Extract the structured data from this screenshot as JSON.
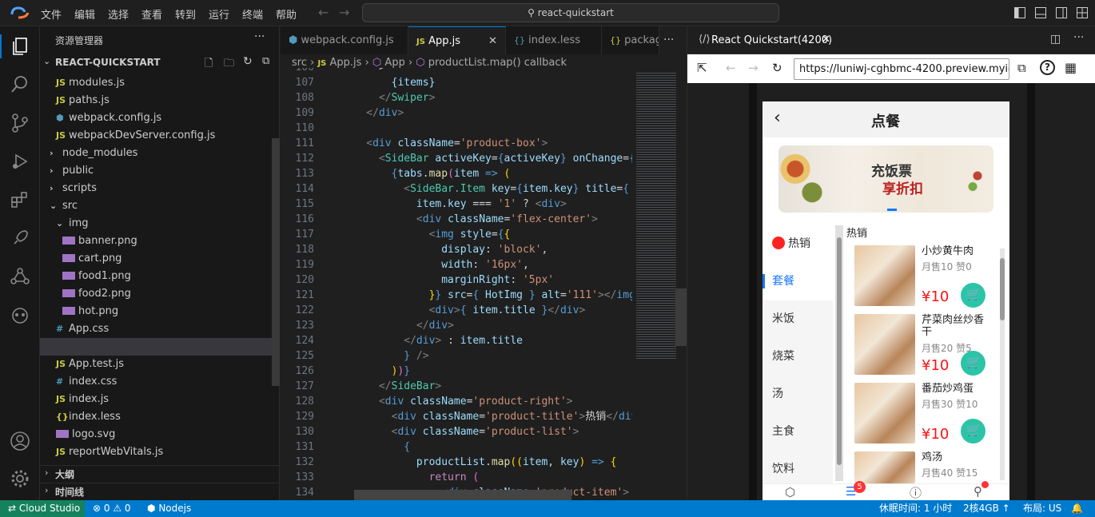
{
  "menu": [
    "文件",
    "编辑",
    "选择",
    "查看",
    "转到",
    "运行",
    "终端",
    "帮助"
  ],
  "search_placeholder": "react-quickstart",
  "explorer": {
    "title": "资源管理器",
    "project": "REACT-QUICKSTART",
    "items": [
      {
        "icon": "JS",
        "label": "modules.js",
        "indent": 1
      },
      {
        "icon": "JS",
        "label": "paths.js",
        "indent": 1
      },
      {
        "icon": "⬢",
        "label": "webpack.config.js",
        "indent": 1
      },
      {
        "icon": "JS",
        "label": "webpackDevServer.config.js",
        "indent": 1
      },
      {
        "icon": "›",
        "label": "node_modules",
        "indent": 0
      },
      {
        "icon": "›",
        "label": "public",
        "indent": 0
      },
      {
        "icon": "›",
        "label": "scripts",
        "indent": 0
      },
      {
        "icon": "⌄",
        "label": "src",
        "indent": 0
      },
      {
        "icon": "⌄",
        "label": "img",
        "indent": 1
      },
      {
        "icon": "",
        "label": "banner.png",
        "indent": 2
      },
      {
        "icon": "",
        "label": "cart.png",
        "indent": 2
      },
      {
        "icon": "",
        "label": "food1.png",
        "indent": 2
      },
      {
        "icon": "",
        "label": "food2.png",
        "indent": 2
      },
      {
        "icon": "",
        "label": "hot.png",
        "indent": 2
      },
      {
        "icon": "#",
        "label": "App.css",
        "indent": 1
      },
      {
        "icon": "JS",
        "label": "App.js",
        "indent": 1
      },
      {
        "icon": "JS",
        "label": "App.test.js",
        "indent": 1
      },
      {
        "icon": "#",
        "label": "index.css",
        "indent": 1
      },
      {
        "icon": "JS",
        "label": "index.js",
        "indent": 1
      },
      {
        "icon": "{}",
        "label": "index.less",
        "indent": 1
      },
      {
        "icon": "",
        "label": "logo.svg",
        "indent": 1
      },
      {
        "icon": "JS",
        "label": "reportWebVitals.js",
        "indent": 1
      }
    ],
    "outline": "大纲",
    "timeline": "时间线"
  },
  "tabs": [
    {
      "icon": "⬢",
      "label": "webpack.config.js"
    },
    {
      "icon": "JS",
      "label": "App.js"
    },
    {
      "icon": "{}",
      "label": "index.less"
    },
    {
      "icon": "{}",
      "label": "packag"
    }
  ],
  "breadcrumb": [
    "src",
    "JS App.js",
    "App",
    "productList.map() callback"
  ],
  "code_lines": [
    {
      "n": "106",
      "html": "<span class=\"w\">      &gt;</span>"
    },
    {
      "n": "107",
      "html": "<span class=\"w\">        </span><span class=\"a\">{items}</span>"
    },
    {
      "n": "108",
      "html": "<span class=\"g\">      &lt;/</span><span class=\"n\">Swiper</span><span class=\"g\">&gt;</span>"
    },
    {
      "n": "109",
      "html": "<span class=\"g\">    &lt;/</span><span class=\"t\">div</span><span class=\"g\">&gt;</span>"
    },
    {
      "n": "110",
      "html": ""
    },
    {
      "n": "111",
      "html": "<span class=\"g\">    &lt;</span><span class=\"t\">div</span> <span class=\"a\">className</span><span class=\"w\">=</span><span class=\"s\">'product-box'</span><span class=\"g\">&gt;</span>"
    },
    {
      "n": "112",
      "html": "<span class=\"g\">      &lt;</span><span class=\"n\">SideBar</span> <span class=\"a\">activeKey</span><span class=\"w\">=</span><span class=\"t\">{</span><span class=\"a\">activeKey</span><span class=\"t\">}</span> <span class=\"a\">onChange</span><span class=\"w\">=</span><span class=\"t\">{</span><span class=\"a\">setA</span>"
    },
    {
      "n": "113",
      "html": "<span class=\"t\">        {</span><span class=\"a\">tabs</span><span class=\"w\">.</span><span class=\"y\">map</span><span class=\"p\">(</span><span class=\"a\">item</span> <span class=\"t\">=&gt;</span> <span class=\"b\">(</span>"
    },
    {
      "n": "114",
      "html": "<span class=\"g\">          &lt;</span><span class=\"n\">SideBar.Item</span> <span class=\"a\">key</span><span class=\"w\">=</span><span class=\"t\">{</span><span class=\"a\">item.key</span><span class=\"t\">}</span> <span class=\"a\">title</span><span class=\"w\">=</span><span class=\"t\">{</span>"
    },
    {
      "n": "115",
      "html": "<span class=\"a\">            item.key</span> <span class=\"w\">===</span> <span class=\"s\">'1'</span> <span class=\"w\">?</span> <span class=\"g\">&lt;</span><span class=\"t\">div</span><span class=\"g\">&gt;</span>"
    },
    {
      "n": "116",
      "html": "<span class=\"g\">            &lt;</span><span class=\"t\">div</span> <span class=\"a\">className</span><span class=\"w\">=</span><span class=\"s\">'flex-center'</span><span class=\"g\">&gt;</span>"
    },
    {
      "n": "117",
      "html": "<span class=\"g\">              &lt;</span><span class=\"t\">img</span> <span class=\"a\">style</span><span class=\"w\">=</span><span class=\"t\">{</span><span class=\"b\">{</span>"
    },
    {
      "n": "118",
      "html": "<span class=\"a\">                display</span><span class=\"w\">:</span> <span class=\"s\">'block'</span><span class=\"w\">,</span>"
    },
    {
      "n": "119",
      "html": "<span class=\"a\">                width</span><span class=\"w\">:</span> <span class=\"s\">'16px'</span><span class=\"w\">,</span>"
    },
    {
      "n": "120",
      "html": "<span class=\"a\">                marginRight</span><span class=\"w\">:</span> <span class=\"s\">'5px'</span>"
    },
    {
      "n": "121",
      "html": "<span class=\"b\">              }</span><span class=\"t\">}</span> <span class=\"a\">src</span><span class=\"w\">=</span><span class=\"t\">{</span> <span class=\"a\">HotImg</span> <span class=\"t\">}</span> <span class=\"a\">alt</span><span class=\"w\">=</span><span class=\"s\">'111'</span><span class=\"g\">&gt;&lt;/</span><span class=\"t\">img</span><span class=\"g\">&gt;</span>"
    },
    {
      "n": "122",
      "html": "<span class=\"g\">              &lt;</span><span class=\"t\">div</span><span class=\"g\">&gt;</span><span class=\"t\">{</span> <span class=\"a\">item.title</span> <span class=\"t\">}</span><span class=\"g\">&lt;/</span><span class=\"t\">div</span><span class=\"g\">&gt;</span>"
    },
    {
      "n": "123",
      "html": "<span class=\"g\">            &lt;/</span><span class=\"t\">div</span><span class=\"g\">&gt;</span>"
    },
    {
      "n": "124",
      "html": "<span class=\"g\">          &lt;/</span><span class=\"t\">div</span><span class=\"g\">&gt;</span> <span class=\"w\">:</span> <span class=\"a\">item.title</span>"
    },
    {
      "n": "125",
      "html": "<span class=\"t\">          }</span> <span class=\"g\">/&gt;</span>"
    },
    {
      "n": "126",
      "html": "<span class=\"b\">        )</span><span class=\"p\">)</span><span class=\"t\">}</span>"
    },
    {
      "n": "127",
      "html": "<span class=\"g\">      &lt;/</span><span class=\"n\">SideBar</span><span class=\"g\">&gt;</span>"
    },
    {
      "n": "128",
      "html": "<span class=\"g\">      &lt;</span><span class=\"t\">div</span> <span class=\"a\">className</span><span class=\"w\">=</span><span class=\"s\">'product-right'</span><span class=\"g\">&gt;</span>"
    },
    {
      "n": "129",
      "html": "<span class=\"g\">        &lt;</span><span class=\"t\">div</span> <span class=\"a\">className</span><span class=\"w\">=</span><span class=\"s\">'product-title'</span><span class=\"g\">&gt;</span><span class=\"w\">热销</span><span class=\"g\">&lt;/</span><span class=\"t\">div</span><span class=\"g\">&gt;</span>"
    },
    {
      "n": "130",
      "html": "<span class=\"g\">        &lt;</span><span class=\"t\">div</span> <span class=\"a\">className</span><span class=\"w\">=</span><span class=\"s\">'product-list'</span><span class=\"g\">&gt;</span>"
    },
    {
      "n": "131",
      "html": "<span class=\"t\">          {</span>"
    },
    {
      "n": "132",
      "html": "<span class=\"a\">            productList</span><span class=\"w\">.</span><span class=\"y\">map</span><span class=\"b\">((</span><span class=\"a\">item</span><span class=\"w\">,</span> <span class=\"a\">key</span><span class=\"b\">)</span> <span class=\"t\">=&gt;</span> <span class=\"b\">{</span>"
    },
    {
      "n": "133",
      "html": "<span class=\"k\">              return</span> <span class=\"p\">(</span>"
    },
    {
      "n": "134",
      "html": "<span class=\"g\">                &lt;</span><span class=\"t\">div</span> <span class=\"a\">className</span><span class=\"w\">=</span><span class=\"s\">'product-item'</span><span class=\"g\">&gt;</span>"
    }
  ],
  "preview": {
    "tab_title": "React Quickstart(4200)",
    "url": "https://luniwj-cghbmc-4200.preview.myide.io",
    "page_title": "点餐",
    "banner_text_1": "充饭票",
    "banner_text_2": "享折扣",
    "sidebar": [
      "热销",
      "套餐",
      "米饭",
      "烧菜",
      "汤",
      "主食",
      "饮料"
    ],
    "section_title": "热销",
    "products": [
      {
        "name": "小炒黄牛肉",
        "meta": "月售10 赞0",
        "price": "¥10"
      },
      {
        "name": "芹菜肉丝炒香干",
        "meta": "月售20 赞5",
        "price": "¥10"
      },
      {
        "name": "番茄炒鸡蛋",
        "meta": "月售30 赞10",
        "price": "¥10"
      },
      {
        "name": "鸡汤",
        "meta": "月售40 赞15",
        "price": ""
      }
    ],
    "cart_badge": "5",
    "accent": "#2bc4a8",
    "price_color": "#ff1111"
  },
  "status": {
    "remote": "Cloud Studio",
    "problems": "⊗ 0 ⚠ 0",
    "runtime": "Nodejs",
    "idle": "休眠时间: 1 小时",
    "resources": "2核4GB",
    "layout": "布局: US"
  }
}
